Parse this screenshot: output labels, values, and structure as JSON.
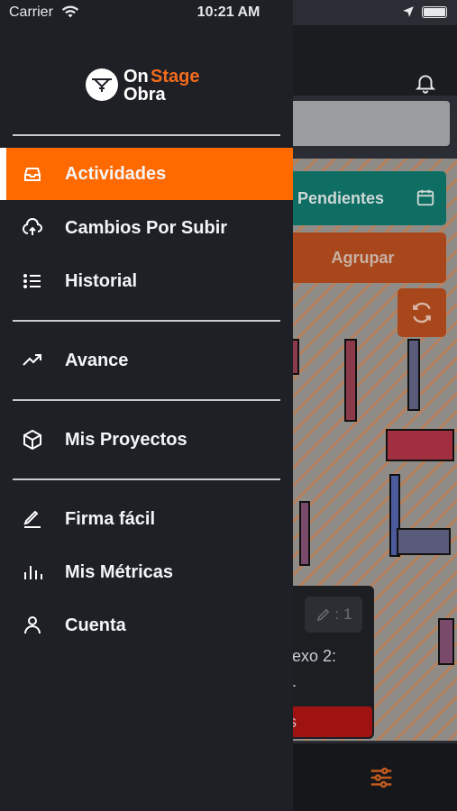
{
  "status_bar": {
    "carrier": "Carrier",
    "time": "10:21 AM"
  },
  "drawer": {
    "logo": {
      "word_on": "On",
      "word_stage": "Stage",
      "word_obra": "Obra"
    },
    "items": [
      {
        "label": "Actividades",
        "icon": "inbox-icon",
        "active": true
      },
      {
        "label": "Cambios Por Subir",
        "icon": "cloud-upload-icon",
        "active": false
      },
      {
        "label": "Historial",
        "icon": "list-icon",
        "active": false
      },
      {
        "label": "Avance",
        "icon": "trending-up-icon",
        "active": false
      },
      {
        "label": "Mis Proyectos",
        "icon": "box-icon",
        "active": false
      },
      {
        "label": "Firma fácil",
        "icon": "pen-icon",
        "active": false
      },
      {
        "label": "Mis Métricas",
        "icon": "bar-chart-icon",
        "active": false
      },
      {
        "label": "Cuenta",
        "icon": "user-icon",
        "active": false
      }
    ]
  },
  "background": {
    "pending_button": "Pendientes",
    "group_button": "Agrupar",
    "card": {
      "chip": ": 1",
      "text_line1": "exo 2:",
      "text_line2": ".",
      "red_label": "es"
    }
  },
  "colors": {
    "accent": "#ff6a00",
    "drawer_bg": "#1e2026",
    "brand_stage": "#f26b1d",
    "pending_teal": "#0f6e63"
  }
}
